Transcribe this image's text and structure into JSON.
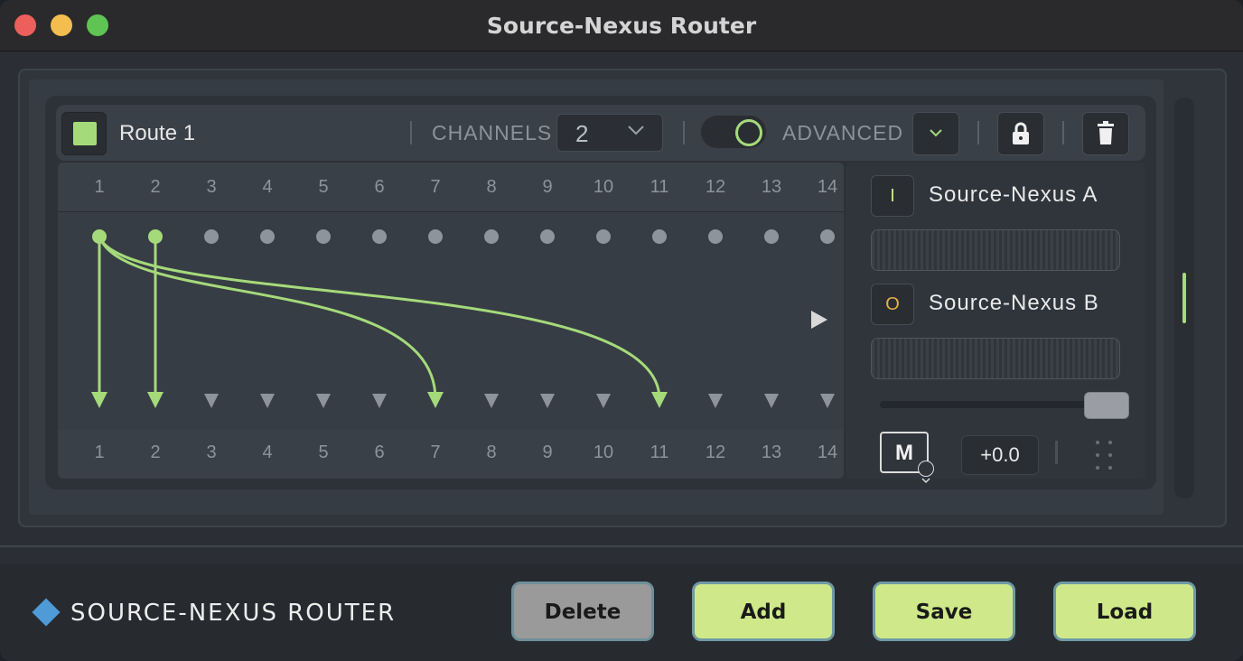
{
  "window": {
    "title": "Source-Nexus Router"
  },
  "route": {
    "name": "Route 1",
    "color": "#a5da7a",
    "channels_label": "CHANNELS",
    "channels_value": "2",
    "advanced_label": "ADVANCED",
    "advanced_enabled": true
  },
  "matrix": {
    "input_channels": [
      "1",
      "2",
      "3",
      "4",
      "5",
      "6",
      "7",
      "8",
      "9",
      "10",
      "11",
      "12",
      "13",
      "14"
    ],
    "output_channels": [
      "1",
      "2",
      "3",
      "4",
      "5",
      "6",
      "7",
      "8",
      "9",
      "10",
      "11",
      "12",
      "13",
      "14"
    ],
    "connections": [
      {
        "from": "1",
        "to": "1"
      },
      {
        "from": "2",
        "to": "2"
      },
      {
        "from": "1",
        "to": "7"
      },
      {
        "from": "1",
        "to": "11"
      }
    ],
    "active_color": "#a5da7a",
    "inactive_color": "#8e949c"
  },
  "side": {
    "source_a": {
      "badge": "I",
      "label": "Source-Nexus A",
      "badge_color": "#cfe98a"
    },
    "source_b": {
      "badge": "O",
      "label": "Source-Nexus B",
      "badge_color": "#e5b24a"
    },
    "mute_label": "M",
    "gain_value": "+0.0"
  },
  "footer": {
    "brand": "SOURCE-NEXUS ROUTER",
    "brand_color": "#4e9bd8",
    "buttons": {
      "delete": "Delete",
      "add": "Add",
      "save": "Save",
      "load": "Load"
    }
  }
}
